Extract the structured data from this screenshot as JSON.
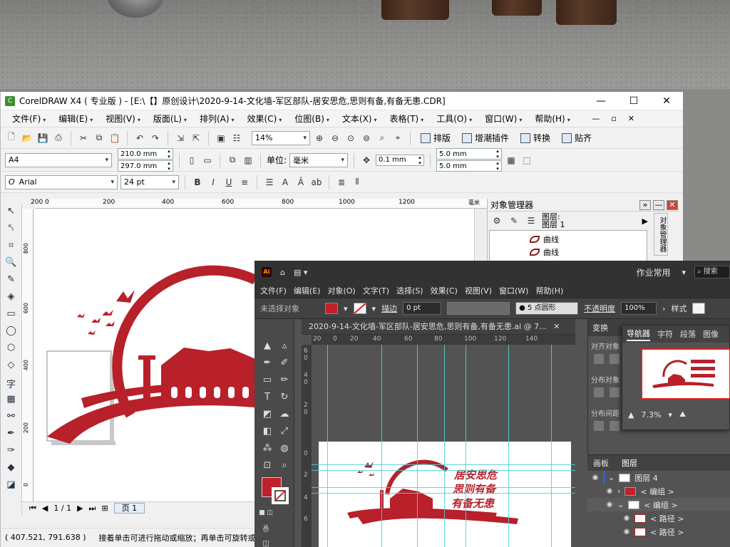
{
  "coreldraw": {
    "title": "CorelDRAW X4 ( 专业版 ) - [E:\\【】原创设计\\2020-9-14-文化墙-军区部队-居安思危,思则有备,有备无患.CDR]",
    "menu": [
      "文件(F)",
      "编辑(E)",
      "视图(V)",
      "版面(L)",
      "排列(A)",
      "效果(C)",
      "位图(B)",
      "文本(X)",
      "表格(T)",
      "工具(O)",
      "窗口(W)",
      "帮助(H)"
    ],
    "zoom": "14%",
    "toolbar_buttons": {
      "typeset": "排版",
      "plugins": "增潮插件",
      "convert": "转换",
      "paste": "贴齐"
    },
    "page_size": "A4",
    "width": "210.0 mm",
    "height": "297.0 mm",
    "unit_label": "单位:",
    "unit_value": "毫米",
    "nudge": "0.1 mm",
    "dup_x": "5.0 mm",
    "dup_y": "5.0 mm",
    "font": "Arial",
    "font_size": "24 pt",
    "ruler_top": [
      "200",
      "0",
      "200",
      "400",
      "600",
      "800",
      "1000",
      "1200"
    ],
    "ruler_unit": "毫米",
    "ruler_left": [
      "800",
      "600",
      "400",
      "200",
      "0"
    ],
    "page_nav": "1 / 1",
    "page_tab": "页 1",
    "status_coords": "( 407.521, 791.638 )",
    "status_hint": "接着单击可进行拖动或缩放；再单击可旋转或倾斜",
    "object_manager": {
      "title": "对象管理器",
      "layer_label": "图层:",
      "layer_value": "图层 1",
      "items": [
        "曲线",
        "曲线"
      ],
      "side_tab": "对象管理器"
    }
  },
  "illustrator": {
    "logo": "Ai",
    "workspace": "作业常用",
    "search": "搜索",
    "menu": [
      "文件(F)",
      "编辑(E)",
      "对象(O)",
      "文字(T)",
      "选择(S)",
      "效果(C)",
      "视图(V)",
      "窗口(W)",
      "帮助(H)"
    ],
    "ctrl": {
      "no_selection": "未选择对象",
      "stroke_label": "描边",
      "stroke_value": "0 pt",
      "brush": "5 点圆形",
      "opacity_label": "不透明度",
      "opacity_value": "100%",
      "style_label": "样式"
    },
    "doc_tab": "2020-9-14-文化墙-军区部队-居安思危,思则有备,有备无患.ai @ 7...",
    "ruler_top": [
      "20",
      "0",
      "20",
      "40",
      "60",
      "80",
      "100",
      "120",
      "140"
    ],
    "ruler_left": [
      "6",
      "0",
      "4",
      "0",
      "2",
      "0",
      "0",
      "2",
      "4",
      "6"
    ],
    "art_slogan": [
      "居安思危",
      "思则有备",
      "有备无患"
    ],
    "panel_tabs_left": [
      "变换",
      "对齐对象",
      "分布对象",
      "分布间距"
    ],
    "navigator": {
      "tabs": [
        "导航器",
        "字符",
        "段落",
        "图像"
      ],
      "zoom": "7.3%"
    },
    "layers": {
      "tabs": [
        "画板",
        "图层"
      ],
      "rows": [
        "图层 4",
        "< 编组 >",
        "< 编组 >",
        "< 路径 >",
        "< 路径 >"
      ]
    }
  },
  "colors": {
    "brand_red": "#b8202a",
    "ai_dark": "#323232"
  }
}
